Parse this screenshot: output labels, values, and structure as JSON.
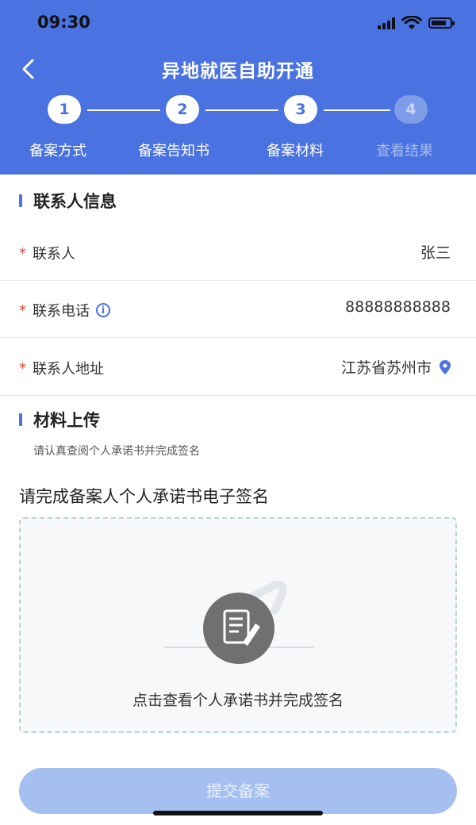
{
  "status_bar": {
    "time": "09:30"
  },
  "header": {
    "title": "异地就医自助开通"
  },
  "steps": [
    {
      "number": "1",
      "label": "备案方式",
      "active": true
    },
    {
      "number": "2",
      "label": "备案告知书",
      "active": true
    },
    {
      "number": "3",
      "label": "备案材料",
      "active": true
    },
    {
      "number": "4",
      "label": "查看结果",
      "active": false
    }
  ],
  "contact_section": {
    "title": "联系人信息",
    "rows": [
      {
        "label": "联系人",
        "value": "张三"
      },
      {
        "label": "联系电话",
        "value": "88888888888"
      },
      {
        "label": "联系人地址",
        "value": "江苏省苏州市"
      }
    ]
  },
  "material_section": {
    "title": "材料上传",
    "hint": "请认真查阅个人承诺书并完成签名",
    "sign_title": "请完成备案人个人承诺书电子签名",
    "sign_caption": "点击查看个人承诺书并完成签名"
  },
  "submit": {
    "label": "提交备案"
  },
  "colors": {
    "brand": "#4a72e0",
    "required": "#e04a3a",
    "submit_disabled": "#a5bff0"
  },
  "icons": [
    "back-arrow-icon",
    "signal-icon",
    "wifi-icon",
    "battery-icon",
    "info-icon",
    "location-pin-icon",
    "document-sign-icon"
  ]
}
